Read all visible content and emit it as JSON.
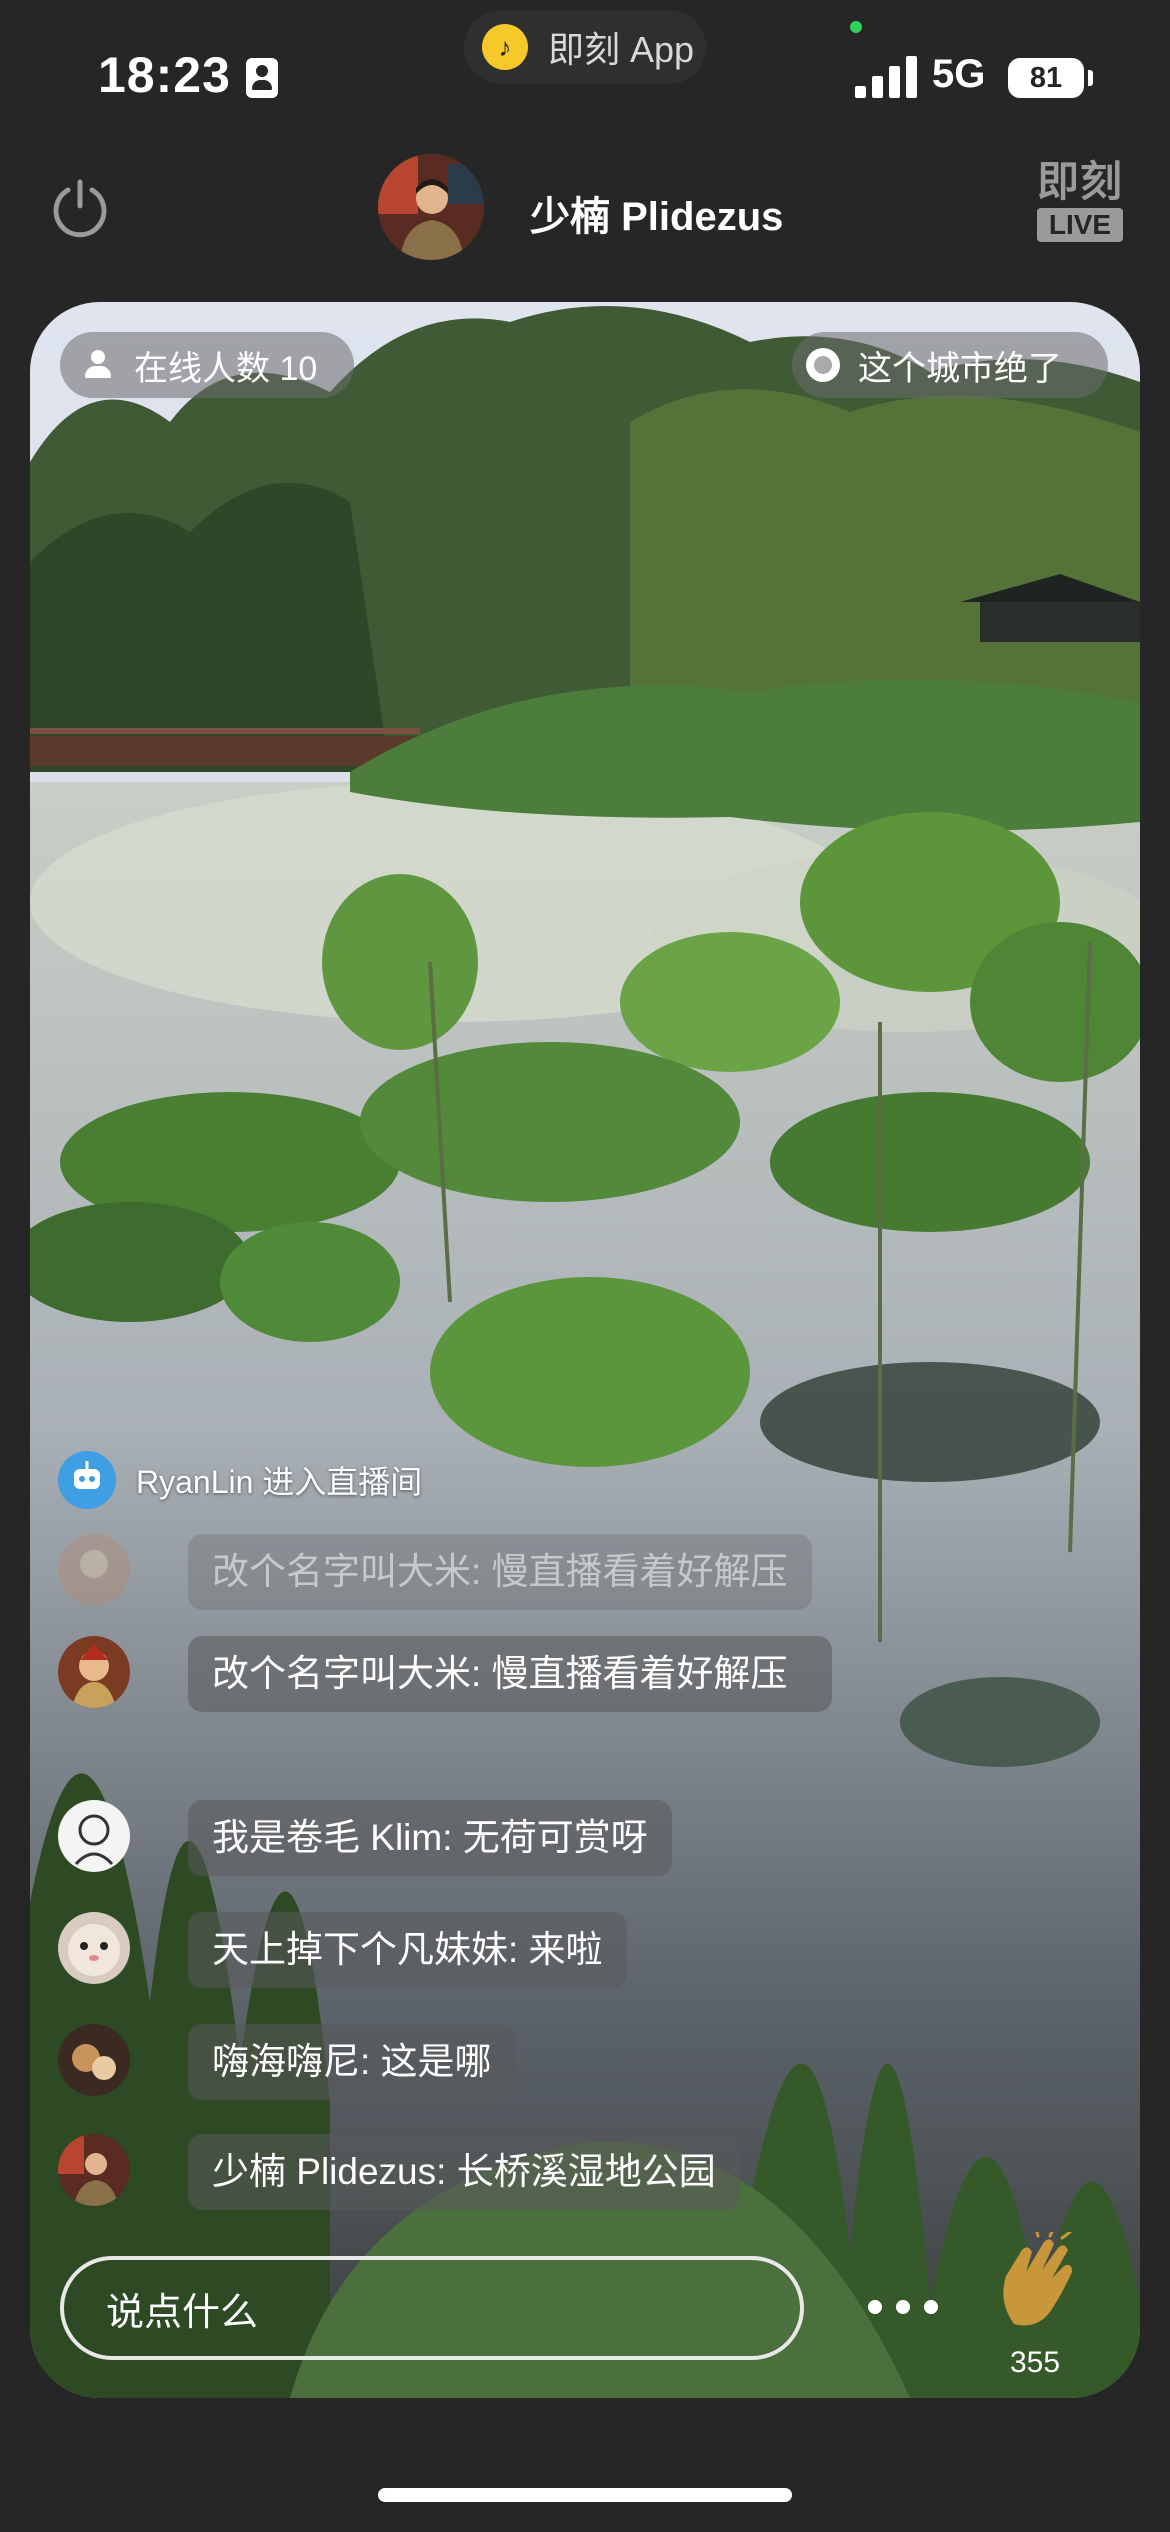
{
  "status_bar": {
    "time": "18:23",
    "network": "5G",
    "battery": "81",
    "island_app_name": "即刻 App",
    "island_logo_glyph": "♪"
  },
  "header": {
    "host_name": "少楠 Plidezus",
    "logo_text": "即刻",
    "logo_badge": "LIVE"
  },
  "stream": {
    "viewer_count_label": "在线人数 10",
    "topic_label": "这个城市绝了"
  },
  "chat": {
    "join_notice": "RyanLin 进入直播间",
    "messages": [
      {
        "text": "改个名字叫大米: 慢直播看着好解压",
        "faded": true
      },
      {
        "text": "改个名字叫大米: 慢直播看着好解压"
      },
      {
        "text": "我是卷毛 Klim: 无荷可赏呀"
      },
      {
        "text": "天上掉下个凡妹妹: 来啦"
      },
      {
        "text": "嗨海嗨尼: 这是哪"
      },
      {
        "text": "少楠 Plidezus: 长桥溪湿地公园"
      }
    ]
  },
  "input": {
    "placeholder": "说点什么",
    "clap_count": "355"
  },
  "colors": {
    "background": "#262626",
    "accent_yellow": "#f6c829",
    "privacy_dot": "#30d158",
    "clap_gold": "#c8973a"
  },
  "icons": [
    "contact-card-icon",
    "signal-icon",
    "battery-icon",
    "power-icon",
    "user-icon",
    "record-icon",
    "more-icon",
    "clap-icon"
  ]
}
